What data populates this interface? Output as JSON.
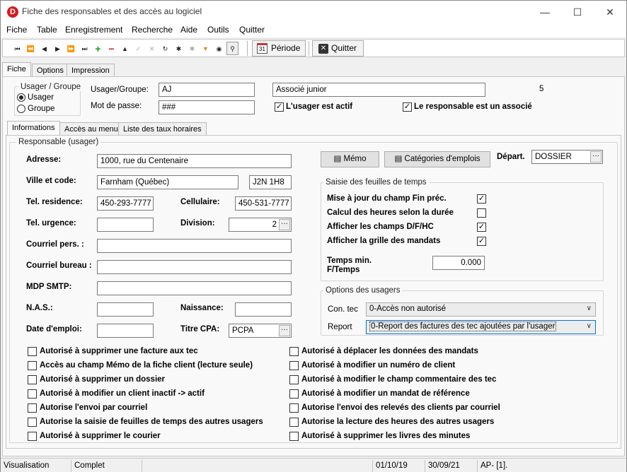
{
  "window": {
    "title": "Fiche des responsables et des accès au logiciel",
    "app_icon": "D"
  },
  "menu": [
    "Fiche",
    "Table",
    "Enregistrement",
    "Recherche",
    "Aide",
    "Outils",
    "Quitter"
  ],
  "toolbar": {
    "periode": "Période",
    "quitter": "Quitter",
    "calendar_day": "31"
  },
  "tabs_top": [
    "Fiche",
    "Options",
    "Impression"
  ],
  "group_usager": {
    "title": "Usager / Groupe",
    "opt1": "Usager",
    "opt2": "Groupe"
  },
  "header": {
    "usager_label": "Usager/Groupe:",
    "usager_value": "AJ",
    "description": "Associé junior",
    "number": "5",
    "mdp_label": "Mot de passe:",
    "mdp_value": "###",
    "actif_label": "L'usager est actif",
    "associe_label": "Le responsable est un associé"
  },
  "tabs_inner": [
    "Informations",
    "Accès au menu",
    "Liste des taux horaires"
  ],
  "responsable": {
    "title": "Responsable (usager)",
    "adresse_label": "Adresse:",
    "adresse": "1000, rue du Centenaire",
    "ville_label": "Ville et code:",
    "ville": "Farnham (Québec)",
    "code": "J2N 1H8",
    "telres_label": "Tel. residence:",
    "telres": "450-293-7777",
    "cell_label": "Cellulaire:",
    "cell": "450-531-7777",
    "telurg_label": "Tel. urgence:",
    "telurg": "",
    "division_label": "Division:",
    "division": "2",
    "courriel_pers_label": "Courriel pers. :",
    "courriel_pers": "",
    "courriel_bureau_label": "Courriel bureau :",
    "courriel_bureau": "",
    "mdp_smtp_label": "MDP SMTP:",
    "mdp_smtp": "",
    "nas_label": "N.A.S.:",
    "nas": "",
    "naissance_label": "Naissance:",
    "naissance": "",
    "date_emploi_label": "Date d'emploi:",
    "date_emploi": "",
    "titre_cpa_label": "Titre CPA:",
    "titre_cpa": "PCPA"
  },
  "buttons": {
    "memo": "Mémo",
    "categories": "Catégories d'emplois"
  },
  "depart": {
    "label": "Départ.",
    "value": "DOSSIER"
  },
  "saisie": {
    "title": "Saisie des feuilles de temps",
    "items": [
      "Mise à jour du champ Fin préc.",
      "Calcul des heures selon la durée",
      "Afficher les champs D/F/HC",
      "Afficher la grille des mandats"
    ],
    "checked": [
      true,
      false,
      true,
      true
    ],
    "tempsmin_label1": "Temps min.",
    "tempsmin_label2": "F/Temps",
    "tempsmin": "0.000"
  },
  "options_usagers": {
    "title": "Options des usagers",
    "contec_label": "Con. tec",
    "contec": "0-Accès non autorisé",
    "report_label": "Report",
    "report": "0-Report des factures des tec ajoutées par l'usager"
  },
  "perms_left": [
    "Autorisé à supprimer une facture aux tec",
    "Accès au champ Mémo de la fiche client (lecture seule)",
    "Autorisé à supprimer un dossier",
    "Autorisé à modifier un client inactif -> actif",
    "Autorise l'envoi par courriel",
    "Autorise la saisie de feuilles de temps des autres usagers",
    "Autorisé à supprimer le courier"
  ],
  "perms_right": [
    "Autorisé à déplacer les données des mandats",
    "Autorisé à modifier un numéro de client",
    "Autorisé à modifier le champ commentaire des tec",
    "Autorisé à modifier un mandat de référence",
    "Autorise l'envoi des relevés des clients par courriel",
    "Autorise la lecture des heures des autres usagers",
    "Autorisé à supprimer les livres des minutes"
  ],
  "status": {
    "mode": "Visualisation",
    "state": "Complet",
    "date1": "01/10/19",
    "date2": "30/09/21",
    "ap": "AP- [1]."
  }
}
